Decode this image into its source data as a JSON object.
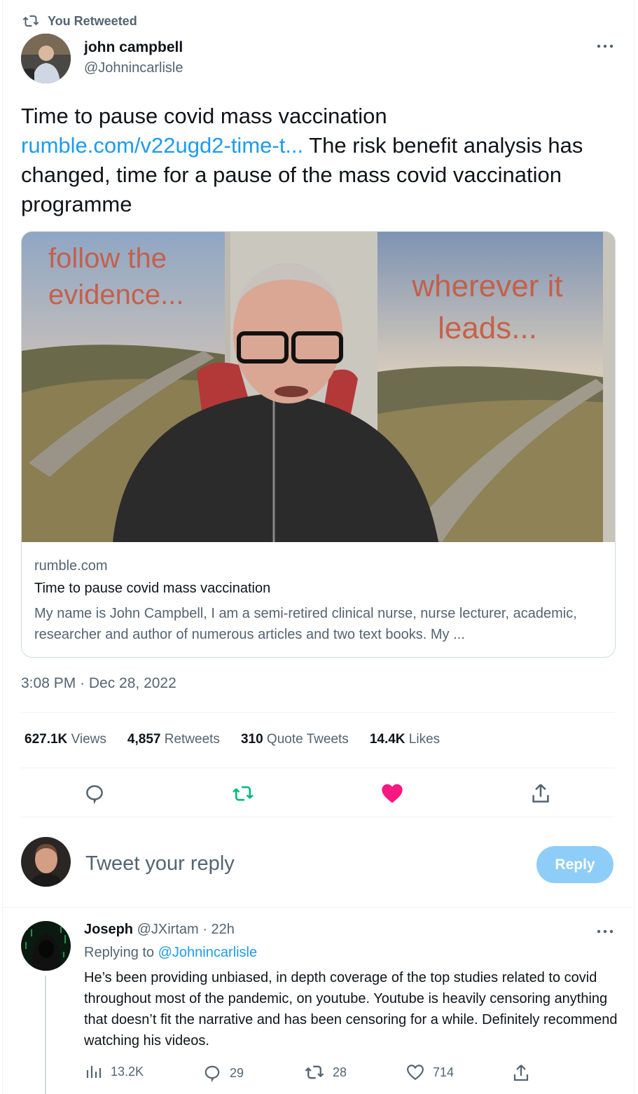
{
  "retweet_banner": {
    "label": "You Retweeted",
    "icon": "retweet-icon"
  },
  "tweet": {
    "author_name": "john campbell",
    "author_handle": "@Johnincarlisle",
    "text_line1": "Time to pause covid mass vaccination",
    "link_text": "rumble.com/v22ugd2-time-t...",
    "text_rest": " The risk benefit analysis has changed, time for a pause of the mass covid vaccination programme",
    "image_overlay_left": "follow the evidence...",
    "image_overlay_right": "wherever it leads...",
    "card": {
      "domain": "rumble.com",
      "title": "Time to pause covid mass vaccination",
      "description": "My name is John Campbell, I am a semi-retired clinical nurse, nurse lecturer, academic, researcher and author of numerous articles and two text books. My ..."
    },
    "timestamp": "3:08 PM · Dec 28, 2022",
    "stats": {
      "views_count": "627.1K",
      "views_label": "Views",
      "retweets_count": "4,857",
      "retweets_label": "Retweets",
      "quotes_count": "310",
      "quotes_label": "Quote Tweets",
      "likes_count": "14.4K",
      "likes_label": "Likes"
    },
    "actions": [
      "reply-icon",
      "retweet-icon",
      "heart-icon",
      "share-icon"
    ],
    "colors": {
      "retweeted": "#00ba7c",
      "liked": "#f91880",
      "link": "#1d9bf0"
    }
  },
  "composer": {
    "placeholder": "Tweet your reply",
    "button_label": "Reply"
  },
  "reply": {
    "author_name": "Joseph",
    "author_handle": "@JXirtam",
    "age": "· 22h",
    "replying_prefix": "Replying to ",
    "replying_handle": "@Johnincarlisle",
    "text": "He’s been providing unbiased, in depth coverage of the top studies related to covid throughout most of the pandemic, on youtube. Youtube is heavily censoring anything that doesn’t fit the narrative and has been censoring for a while. Definitely recommend watching his videos.",
    "views": "13.2K",
    "replies": "29",
    "retweets": "28",
    "likes": "714"
  }
}
